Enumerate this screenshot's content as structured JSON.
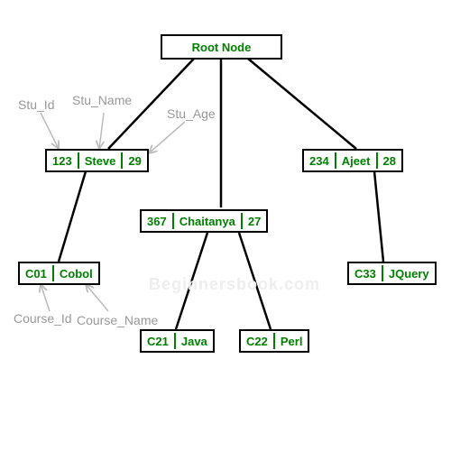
{
  "root": {
    "label": "Root Node"
  },
  "students": [
    {
      "id": "123",
      "name": "Steve",
      "age": "29"
    },
    {
      "id": "234",
      "name": "Ajeet",
      "age": "28"
    },
    {
      "id": "367",
      "name": "Chaitanya",
      "age": "27"
    }
  ],
  "courses": [
    {
      "id": "C01",
      "name": "Cobol"
    },
    {
      "id": "C33",
      "name": "JQuery"
    },
    {
      "id": "C21",
      "name": "Java"
    },
    {
      "id": "C22",
      "name": "Perl"
    }
  ],
  "field_labels": {
    "stu_id": "Stu_Id",
    "stu_name": "Stu_Name",
    "stu_age": "Stu_Age",
    "course_id": "Course_Id",
    "course_name": "Course_Name"
  },
  "watermark": "Beginnersbook.com"
}
